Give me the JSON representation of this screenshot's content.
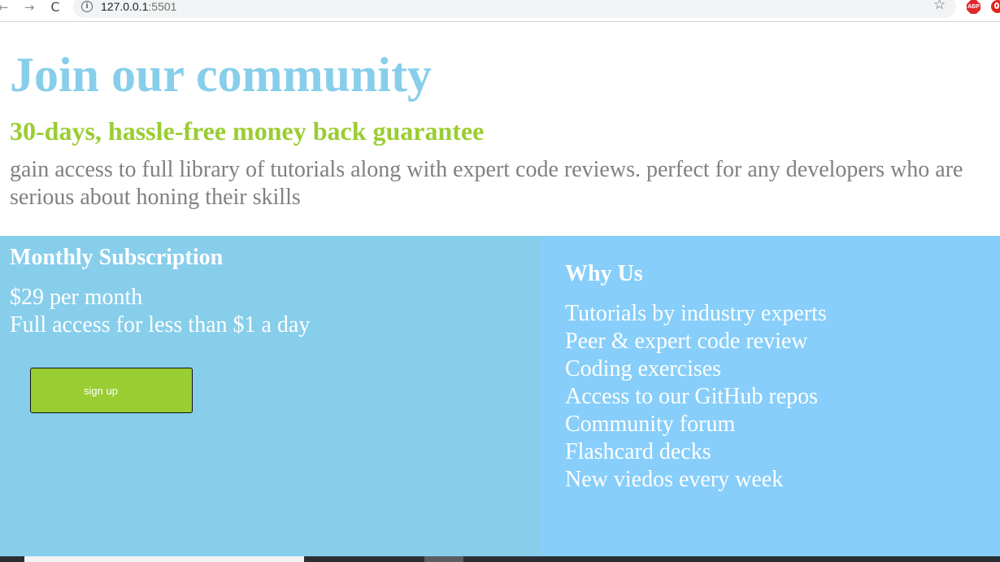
{
  "browser": {
    "url_host": "127.0.0.1",
    "url_port": ":5501",
    "back_glyph": "←",
    "forward_glyph": "→",
    "reload_glyph": "C",
    "info_glyph": "i",
    "star_glyph": "☆",
    "abp_label": "ABP",
    "icons": [
      "back-arrow-icon",
      "forward-arrow-icon",
      "reload-icon",
      "info-icon",
      "star-icon",
      "adblock-plus-icon",
      "opera-icon"
    ]
  },
  "hero": {
    "title": "Join our community",
    "subtitle": "30-days, hassle-free money back guarantee",
    "description": "gain access to full library of tutorials along with expert code reviews. perfect for any developers who are serious about honing their skills"
  },
  "subscription": {
    "title": "Monthly Subscription",
    "price": "$29 per month",
    "note": "Full access for less than $1 a day",
    "button_label": "sign up"
  },
  "why_us": {
    "title": "Why Us",
    "items": [
      "Tutorials by industry experts",
      "Peer & expert code review",
      "Coding exercises",
      "Access to our GitHub repos",
      "Community forum",
      "Flashcard decks",
      "New viedos every week"
    ]
  },
  "colors": {
    "title_blue": "#87ceeb",
    "subtitle_green": "#9acd32",
    "description_gray": "#808080",
    "left_panel_bg": "#87ceeb",
    "right_panel_bg": "#87cefa",
    "button_bg": "#9acd32"
  }
}
